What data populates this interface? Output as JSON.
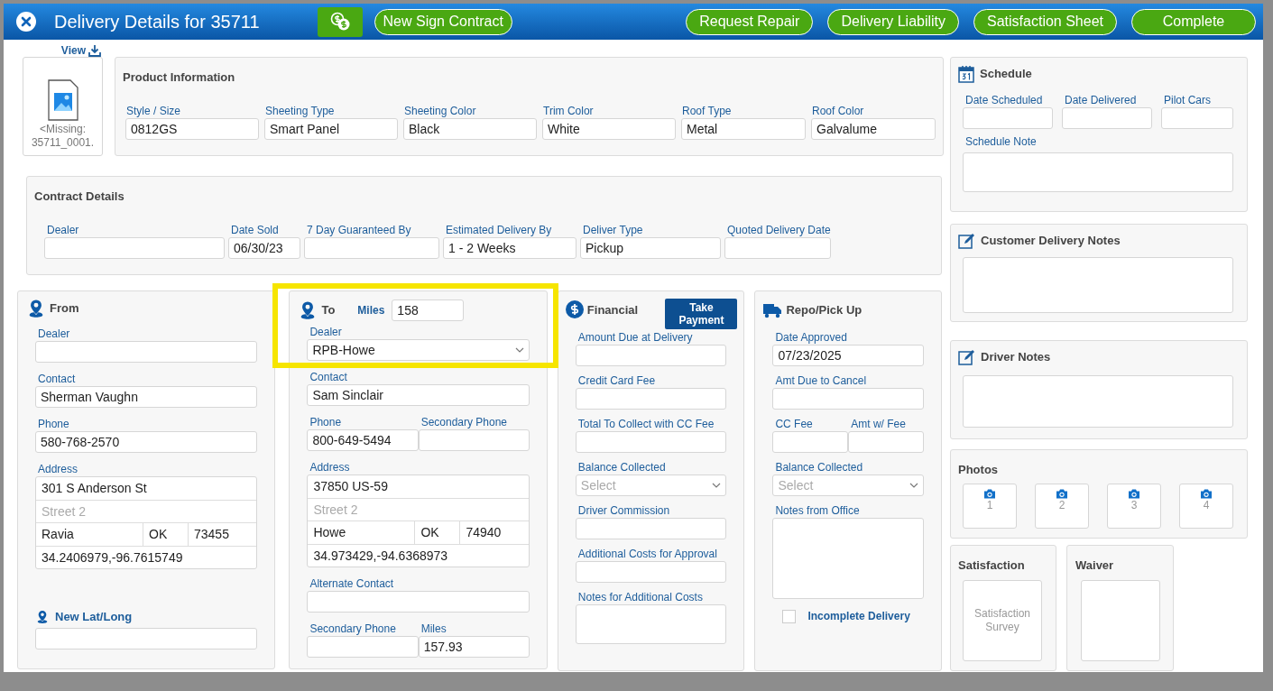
{
  "header": {
    "title": "Delivery Details for 35711",
    "buttons": [
      {
        "kind": "icon"
      },
      {
        "kind": "text",
        "label": "New Sign Contract"
      }
    ],
    "actions": [
      "Request Repair",
      "Delivery Liability",
      "Satisfaction Sheet",
      "Complete"
    ]
  },
  "image": {
    "link": "View",
    "caption": "<Missing: 35711_0001."
  },
  "product_info": {
    "title": "Product Information",
    "fields": [
      {
        "label": "Style / Size",
        "value": "0812GS"
      },
      {
        "label": "Sheeting Type",
        "value": "Smart Panel"
      },
      {
        "label": "Sheeting Color",
        "value": "Black"
      },
      {
        "label": "Trim Color",
        "value": "White"
      },
      {
        "label": "Roof Type",
        "value": "Metal"
      },
      {
        "label": "Roof Color",
        "value": "Galvalume"
      }
    ]
  },
  "contract_details": {
    "title": "Contract Details",
    "fields": [
      {
        "label": "Dealer"
      },
      {
        "label": "Date Sold",
        "value": "06/30/23"
      },
      {
        "label": "7 Day Guaranteed By"
      },
      {
        "label": "Estimated Delivery By",
        "value": "1 - 2 Weeks"
      },
      {
        "label": "Deliver Type",
        "value": "Pickup"
      },
      {
        "label": "Quoted Delivery Date"
      }
    ]
  },
  "from": {
    "title": "From",
    "rows": [
      [
        {
          "kind": "input",
          "label": "Dealer"
        }
      ],
      [
        {
          "kind": "input",
          "label": "Contact",
          "value": "Sherman Vaughn"
        }
      ],
      [
        {
          "kind": "input",
          "label": "Phone",
          "value": "580-768-2570"
        }
      ],
      [
        {
          "kind": "address",
          "label": "Address",
          "street": "301 S Anderson St",
          "street2_placeholder": "Street 2",
          "city": "Ravia",
          "state": "OK",
          "zip": "73455",
          "coords": "34.2406979,-96.7615749"
        }
      ]
    ],
    "new_latlong": {
      "label": "New Lat/Long"
    }
  },
  "to": {
    "title": "To",
    "highlighted": true,
    "miles": {
      "label": "Miles",
      "value": "158"
    },
    "rows": [
      [
        {
          "kind": "select",
          "label": "Dealer",
          "value": "RPB-Howe"
        }
      ],
      [
        {
          "kind": "input",
          "label": "Contact",
          "value": "Sam Sinclair"
        }
      ],
      [
        {
          "kind": "input",
          "label": "Phone",
          "value": "800-649-5494"
        },
        {
          "kind": "input",
          "label": "Secondary Phone"
        }
      ],
      [
        {
          "kind": "address",
          "label": "Address",
          "street": "37850 US-59",
          "street2_placeholder": "Street 2",
          "city": "Howe",
          "state": "OK",
          "zip": "74940",
          "coords": "34.973429,-94.6368973"
        }
      ],
      [
        {
          "kind": "input",
          "label": "Alternate Contact"
        }
      ],
      [
        {
          "kind": "input",
          "label": "Secondary Phone"
        },
        {
          "kind": "input",
          "label": "Miles",
          "value": "157.93"
        }
      ]
    ]
  },
  "financial": {
    "title": "Financial",
    "action": "Take Payment",
    "rows": [
      [
        {
          "kind": "input",
          "label": "Amount Due at Delivery"
        }
      ],
      [
        {
          "kind": "input",
          "label": "Credit Card Fee"
        }
      ],
      [
        {
          "kind": "input",
          "label": "Total To Collect with CC Fee"
        }
      ],
      [
        {
          "kind": "select",
          "label": "Balance Collected",
          "placeholder": "Select"
        }
      ],
      [
        {
          "kind": "input",
          "label": "Driver Commission"
        }
      ],
      [
        {
          "kind": "input",
          "label": "Additional Costs for Approval"
        }
      ],
      [
        {
          "kind": "textarea",
          "label": "Notes for Additional Costs"
        }
      ]
    ]
  },
  "repo": {
    "title": "Repo/Pick Up",
    "rows": [
      [
        {
          "kind": "input",
          "label": "Date Approved",
          "value": "07/23/2025"
        }
      ],
      [
        {
          "kind": "input",
          "label": "Amt Due to Cancel"
        }
      ],
      [
        {
          "kind": "input",
          "label": "CC Fee"
        },
        {
          "kind": "input",
          "label": "Amt w/ Fee"
        }
      ],
      [
        {
          "kind": "select",
          "label": "Balance Collected",
          "placeholder": "Select"
        }
      ],
      [
        {
          "kind": "textarea",
          "label": "Notes from Office"
        }
      ]
    ],
    "checkbox": {
      "label": "Incomplete Delivery",
      "checked": false
    }
  },
  "schedule": {
    "title": "Schedule",
    "fields": [
      {
        "label": "Date Scheduled"
      },
      {
        "label": "Date Delivered"
      },
      {
        "label": "Pilot Cars"
      }
    ],
    "note": {
      "label": "Schedule Note"
    }
  },
  "customer_notes": {
    "title": "Customer Delivery Notes"
  },
  "driver_notes": {
    "title": "Driver Notes"
  },
  "photos": {
    "title": "Photos",
    "slots": [
      "1",
      "2",
      "3",
      "4"
    ]
  },
  "satisfaction": {
    "title": "Satisfaction",
    "tile": "Satisfaction Survey"
  },
  "waiver": {
    "title": "Waiver"
  }
}
